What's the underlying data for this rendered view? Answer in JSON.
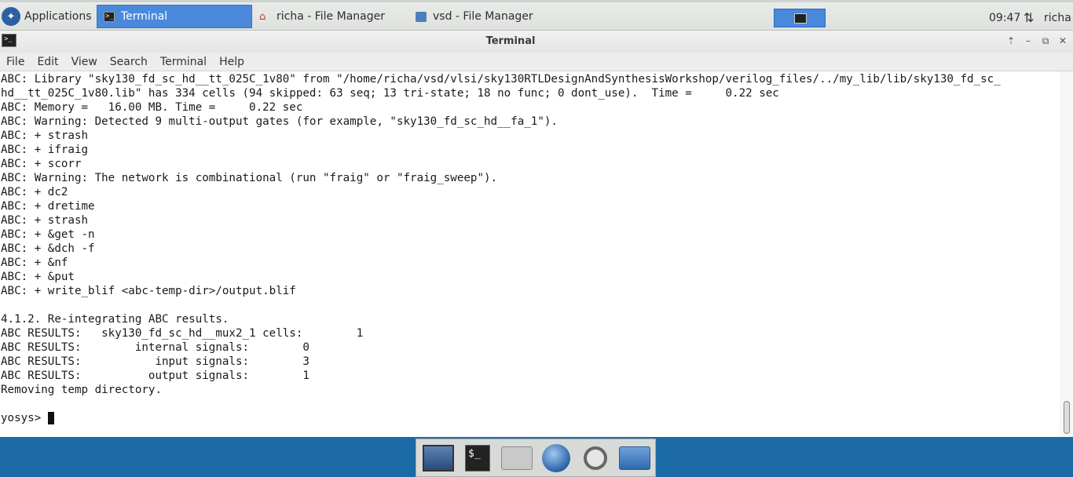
{
  "top_panel": {
    "applications_label": "Applications",
    "tasks": [
      {
        "label": "Terminal",
        "icon": "terminal-icon",
        "active": true
      },
      {
        "label": "richa - File Manager",
        "icon": "home-folder-icon",
        "active": false
      },
      {
        "label": "vsd - File Manager",
        "icon": "folder-icon",
        "active": false
      }
    ],
    "clock": "09:47",
    "network_icon": "⇅",
    "user": "richa"
  },
  "window": {
    "title": "Terminal",
    "menu": [
      "File",
      "Edit",
      "View",
      "Search",
      "Terminal",
      "Help"
    ],
    "terminal_lines": [
      "ABC: Library \"sky130_fd_sc_hd__tt_025C_1v80\" from \"/home/richa/vsd/vlsi/sky130RTLDesignAndSynthesisWorkshop/verilog_files/../my_lib/lib/sky130_fd_sc_",
      "hd__tt_025C_1v80.lib\" has 334 cells (94 skipped: 63 seq; 13 tri-state; 18 no func; 0 dont_use).  Time =     0.22 sec",
      "ABC: Memory =   16.00 MB. Time =     0.22 sec",
      "ABC: Warning: Detected 9 multi-output gates (for example, \"sky130_fd_sc_hd__fa_1\").",
      "ABC: + strash",
      "ABC: + ifraig",
      "ABC: + scorr",
      "ABC: Warning: The network is combinational (run \"fraig\" or \"fraig_sweep\").",
      "ABC: + dc2",
      "ABC: + dretime",
      "ABC: + strash",
      "ABC: + &get -n",
      "ABC: + &dch -f",
      "ABC: + &nf",
      "ABC: + &put",
      "ABC: + write_blif <abc-temp-dir>/output.blif",
      "",
      "4.1.2. Re-integrating ABC results.",
      "ABC RESULTS:   sky130_fd_sc_hd__mux2_1 cells:        1",
      "ABC RESULTS:        internal signals:        0",
      "ABC RESULTS:           input signals:        3",
      "ABC RESULTS:          output signals:        1",
      "Removing temp directory.",
      ""
    ],
    "prompt": "yosys> "
  },
  "dock": {
    "items": [
      "desktop-icon",
      "terminal-icon",
      "home-folder-icon",
      "web-browser-icon",
      "search-icon",
      "files-icon"
    ],
    "terminal_glyph": "$_"
  }
}
